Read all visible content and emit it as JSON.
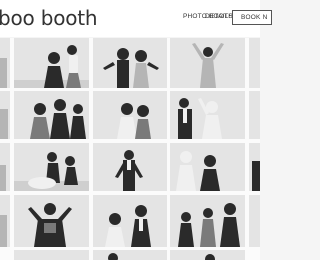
{
  "header": {
    "brand": "boo booth",
    "nav": [
      {
        "label": "PHOTO BOOTH"
      },
      {
        "label": "DETAILS"
      }
    ],
    "book_button": "BOOK N"
  },
  "gallery": {
    "photo_count": 20,
    "columns": 5,
    "rows": 4
  },
  "colors": {
    "header_bg": "#ffffff",
    "page_bg": "#f5f5f5",
    "text": "#333333"
  }
}
